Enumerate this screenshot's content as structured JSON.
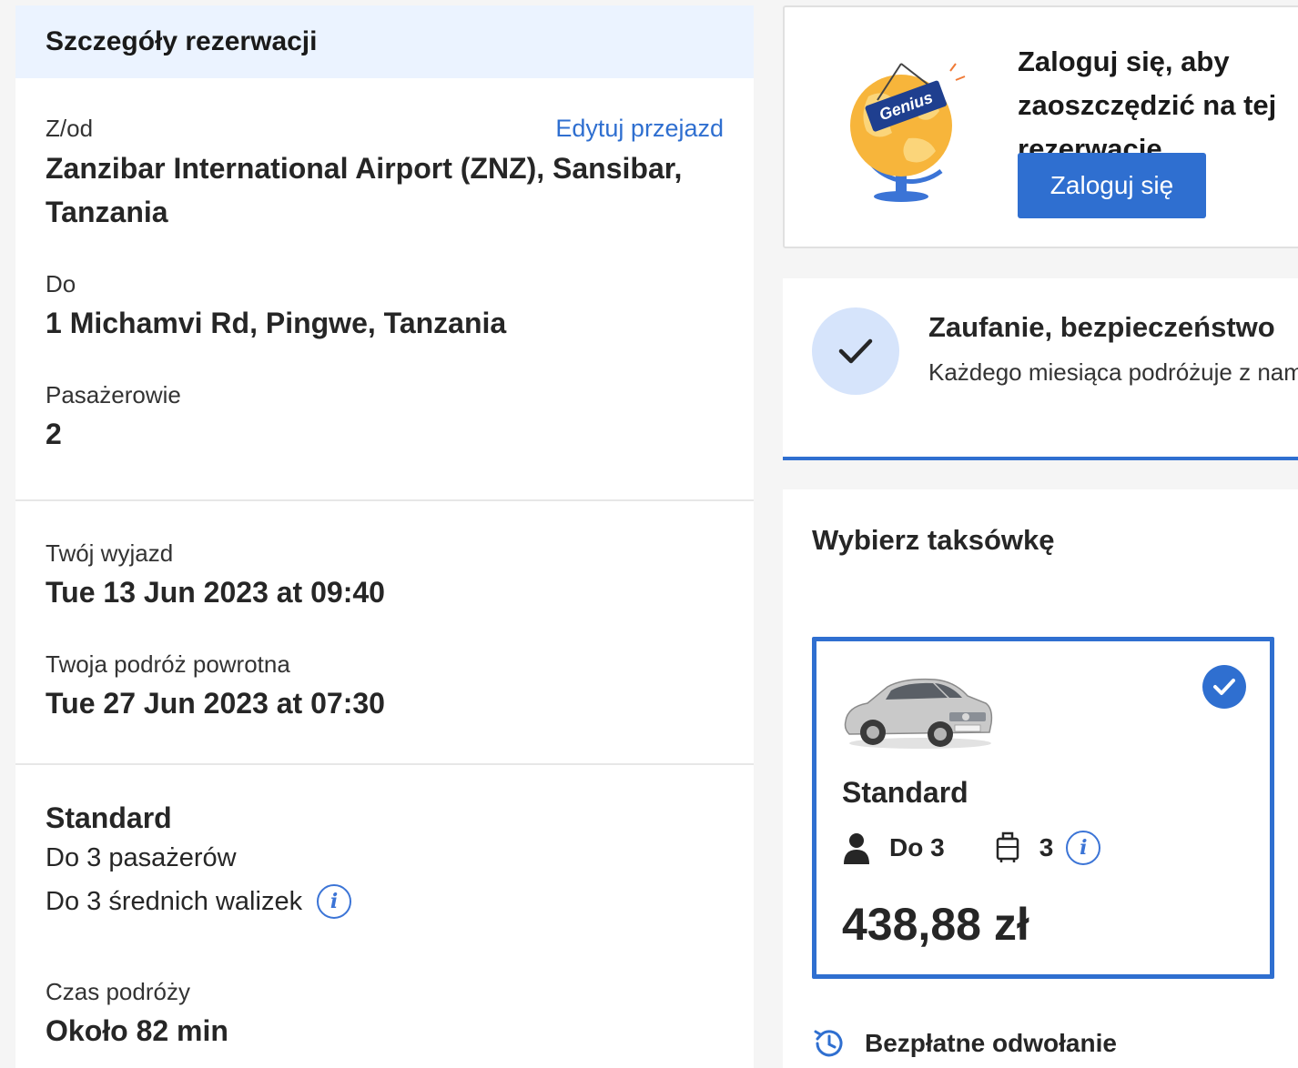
{
  "booking_details": {
    "header": "Szczegóły rezerwacji",
    "from_label": "Z/od",
    "edit_link": "Edytuj przejazd",
    "from_value": "Zanzibar International Airport (ZNZ), Sansibar, Tanzania",
    "to_label": "Do",
    "to_value": "1 Michamvi Rd, Pingwe, Tanzania",
    "passengers_label": "Pasażerowie",
    "passengers_value": "2",
    "departure_label": "Twój wyjazd",
    "departure_value": "Tue 13 Jun 2023 at 09:40",
    "return_label": "Twoja podróż powrotna",
    "return_value": "Tue 27 Jun 2023 at 07:30",
    "vehicle_class": "Standard",
    "vehicle_passengers": "Do 3 pasażerów",
    "vehicle_luggage": "Do 3 średnich walizek",
    "travel_time_label": "Czas podróży",
    "travel_time_value": "Około 82 min"
  },
  "login_card": {
    "badge_text": "Genius",
    "text": "Zaloguj się, aby zaoszczędzić na tej rezerwację",
    "button": "Zaloguj się"
  },
  "trust_card": {
    "title": "Zaufanie, bezpieczeństwo",
    "subtitle": "Każdego miesiąca podróżuje z nami"
  },
  "taxi_selection": {
    "title": "Wybierz taksówkę",
    "option": {
      "class": "Standard",
      "passengers": "Do 3",
      "luggage": "3",
      "price": "438,88 zł",
      "selected": true
    },
    "free_cancellation": "Bezpłatne odwołanie"
  },
  "colors": {
    "accent_blue": "#2f6fd0",
    "header_bg": "#ebf3ff",
    "check_bg": "#d6e4fb"
  }
}
